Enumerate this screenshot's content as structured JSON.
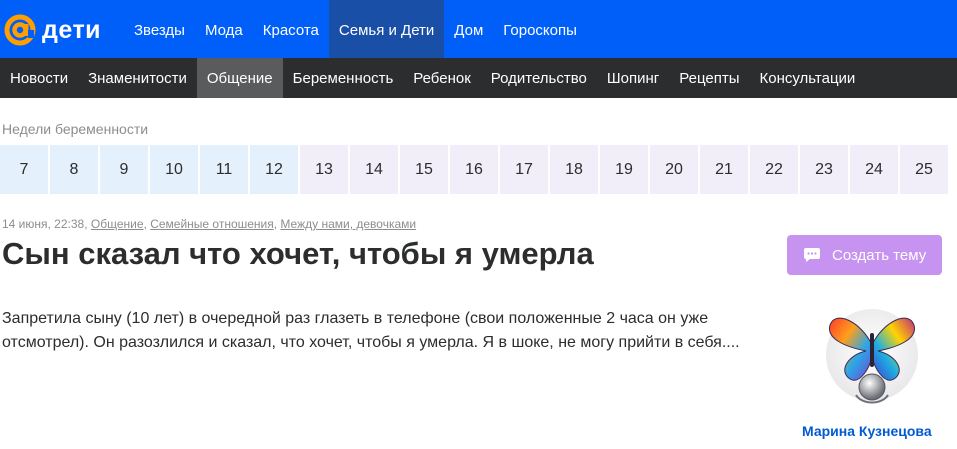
{
  "brand": {
    "logo_text": "дети"
  },
  "top_nav": {
    "items": [
      {
        "label": "Звезды"
      },
      {
        "label": "Мода"
      },
      {
        "label": "Красота"
      },
      {
        "label": "Семья и Дети",
        "active": true
      },
      {
        "label": "Дом"
      },
      {
        "label": "Гороскопы"
      }
    ]
  },
  "sub_nav": {
    "items": [
      {
        "label": "Новости"
      },
      {
        "label": "Знаменитости"
      },
      {
        "label": "Общение",
        "active": true
      },
      {
        "label": "Беременность"
      },
      {
        "label": "Ребенок"
      },
      {
        "label": "Родительство"
      },
      {
        "label": "Шопинг"
      },
      {
        "label": "Рецепты"
      },
      {
        "label": "Консультации"
      }
    ]
  },
  "pregnancy_weeks": {
    "label": "Недели беременности",
    "weeks": [
      "7",
      "8",
      "9",
      "10",
      "11",
      "12",
      "13",
      "14",
      "15",
      "16",
      "17",
      "18",
      "19",
      "20",
      "21",
      "22",
      "23",
      "24",
      "25"
    ],
    "highlighted_until": "12"
  },
  "post": {
    "date": "14 июня, 22:38,",
    "categories": [
      "Общение",
      "Семейные отношения",
      "Между нами, девочками"
    ],
    "title": "Сын сказал что хочет, чтобы я умерла",
    "text": "Запретила сыну (10 лет) в очередной раз глазеть в телефоне (свои положенные 2 часа он уже отсмотрел). Он разозлился и сказал, что хочет, чтобы я умерла. Я в шоке, не могу прийти в себя....",
    "author": "Марина Кузнецова"
  },
  "actions": {
    "create_topic": "Создать тему"
  },
  "colors": {
    "top_bar": "#005ff9",
    "top_active": "#1a4fa8",
    "sub_bar": "#2c2d2e",
    "sub_active": "#5a5b5c",
    "week_past": "#e4f1fc",
    "week_future": "#f1eef9",
    "create_button": "#c693f0",
    "author_link": "#005bd1"
  },
  "icons": [
    "at-logo-icon",
    "chat-icon",
    "butterfly-avatar"
  ]
}
